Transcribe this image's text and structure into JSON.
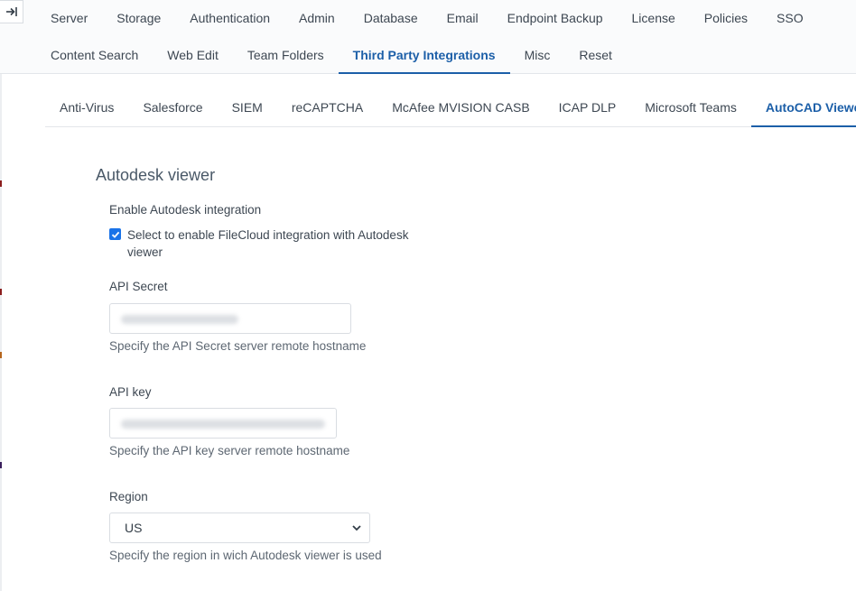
{
  "top_nav": {
    "row1": [
      "Server",
      "Storage",
      "Authentication",
      "Admin",
      "Database",
      "Email",
      "Endpoint Backup",
      "License",
      "Policies",
      "SSO"
    ],
    "row2": [
      "Content Search",
      "Web Edit",
      "Team Folders",
      "Third Party Integrations",
      "Misc",
      "Reset"
    ],
    "active": "Third Party Integrations"
  },
  "sub_tabs": {
    "items": [
      "Anti-Virus",
      "Salesforce",
      "SIEM",
      "reCAPTCHA",
      "McAfee MVISION CASB",
      "ICAP DLP",
      "Microsoft Teams",
      "AutoCAD Viewer"
    ],
    "active": "AutoCAD Viewer"
  },
  "section": {
    "title": "Autodesk viewer",
    "enable_label": "Enable Autodesk integration",
    "enable_checkbox_text": "Select to enable FileCloud integration with Autodesk viewer",
    "enable_checked": true,
    "api_secret_label": "API Secret",
    "api_secret_help": "Specify the API Secret server remote hostname",
    "api_key_label": "API key",
    "api_key_help": "Specify the API key server remote hostname",
    "region_label": "Region",
    "region_value": "US",
    "region_help": "Specify the region in wich Autodesk viewer is used"
  },
  "colors": {
    "accent": "#1c5fa8",
    "checkbox": "#1a73e8",
    "left_ticks": [
      "#8b1e1e",
      "#b5651d",
      "#3a1f5c"
    ]
  },
  "icons": {
    "collapse": "expand-panel-icon",
    "checkbox": "checkmark-icon",
    "select": "chevron-down-icon"
  }
}
